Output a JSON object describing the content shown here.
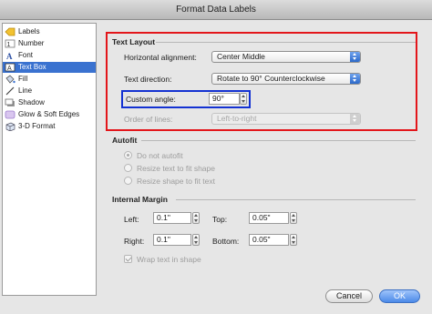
{
  "window": {
    "title": "Format Data Labels"
  },
  "sidebar": {
    "items": [
      {
        "label": "Labels",
        "icon": "label-tag-icon",
        "selected": false
      },
      {
        "label": "Number",
        "icon": "number-icon",
        "selected": false
      },
      {
        "label": "Font",
        "icon": "font-icon",
        "selected": false
      },
      {
        "label": "Text Box",
        "icon": "text-box-icon",
        "selected": true
      },
      {
        "label": "Fill",
        "icon": "fill-bucket-icon",
        "selected": false
      },
      {
        "label": "Line",
        "icon": "line-pen-icon",
        "selected": false
      },
      {
        "label": "Shadow",
        "icon": "shadow-icon",
        "selected": false
      },
      {
        "label": "Glow & Soft Edges",
        "icon": "glow-icon",
        "selected": false
      },
      {
        "label": "3-D Format",
        "icon": "three-d-icon",
        "selected": false
      }
    ]
  },
  "text_layout": {
    "title": "Text Layout",
    "horizontal_alignment": {
      "label": "Horizontal alignment:",
      "value": "Center Middle"
    },
    "text_direction": {
      "label": "Text direction:",
      "value": "Rotate to 90° Counterclockwise"
    },
    "custom_angle": {
      "label": "Custom angle:",
      "value": "90°"
    },
    "order_of_lines": {
      "label": "Order of lines:",
      "value": "Left-to-right"
    }
  },
  "autofit": {
    "title": "Autofit",
    "options": [
      "Do not autofit",
      "Resize text to fit shape",
      "Resize shape to fit text"
    ],
    "selected": 0
  },
  "internal_margin": {
    "title": "Internal Margin",
    "left": {
      "label": "Left:",
      "value": "0.1\""
    },
    "top": {
      "label": "Top:",
      "value": "0.05\""
    },
    "right": {
      "label": "Right:",
      "value": "0.1\""
    },
    "bottom": {
      "label": "Bottom:",
      "value": "0.05\""
    },
    "wrap_text": {
      "label": "Wrap text in shape",
      "checked": true
    }
  },
  "buttons": {
    "cancel": "Cancel",
    "ok": "OK"
  },
  "colors": {
    "highlight_red": "#e3161b",
    "highlight_blue": "#1432d2",
    "selection": "#3a72d0",
    "accent": "#4b8ae8"
  }
}
